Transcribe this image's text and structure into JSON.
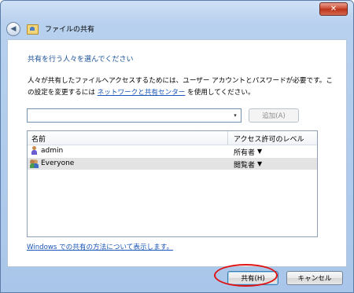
{
  "window": {
    "close_glyph": "✕",
    "title": "ファイルの共有",
    "back_glyph": "◀"
  },
  "main": {
    "heading": "共有を行う人々を選んでください",
    "description_part1": "人々が共有したファイルへアクセスするためには、ユーザー アカウントとパスワードが必要です。この設定を変更するには ",
    "description_link": "ネットワークと共有センター",
    "description_part2": " を使用してください。",
    "combo_value": "",
    "combo_arrow": "▾",
    "add_button_label": "追加(A)"
  },
  "list": {
    "columns": [
      "名前",
      "アクセス許可のレベル"
    ],
    "rows": [
      {
        "name": "admin",
        "level": "所有者",
        "dropdown": "▼"
      },
      {
        "name": "Everyone",
        "level": "閲覧者",
        "dropdown": "▼"
      }
    ]
  },
  "help_link": "Windows での共有の方法について表示します。",
  "footer": {
    "share_label": "共有(H)",
    "cancel_label": "キャンセル"
  },
  "colors": {
    "heading": "#174f96",
    "link": "#1a55b8",
    "highlight": "#e01414"
  }
}
